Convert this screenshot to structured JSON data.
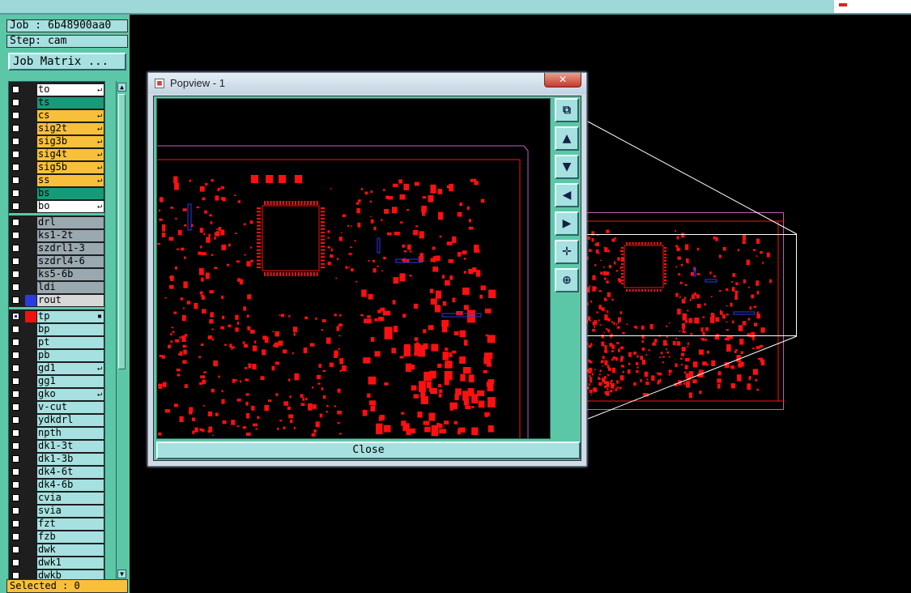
{
  "job_label": "Job : 6b48900aa0",
  "step_label": "Step: cam",
  "job_matrix_button": "Job Matrix ...",
  "selected_label": "Selected : 0",
  "popview_title": "Popview - 1",
  "close_button": "Close",
  "close_x": "✕",
  "colors": {
    "panel": "#5cc7a7",
    "light": "#a6e0e0",
    "orange": "#f8c03a",
    "teal": "#169a7a",
    "white": "#ffffff",
    "grey": "#9aa8b0",
    "copper": "#ff1010",
    "outline": "#c05cc0"
  },
  "layers": [
    {
      "name": "to",
      "bg": "#ffffff",
      "mark": "↵"
    },
    {
      "name": "ts",
      "bg": "#169a7a",
      "mark": ""
    },
    {
      "name": "cs",
      "bg": "#f8c03a",
      "mark": "↵"
    },
    {
      "name": "sig2t",
      "bg": "#f8c03a",
      "mark": "↵"
    },
    {
      "name": "sig3b",
      "bg": "#f8c03a",
      "mark": "↵"
    },
    {
      "name": "sig4t",
      "bg": "#f8c03a",
      "mark": "↵"
    },
    {
      "name": "sig5b",
      "bg": "#f8c03a",
      "mark": "↵"
    },
    {
      "name": "ss",
      "bg": "#f8c03a",
      "mark": "↵"
    },
    {
      "name": "bs",
      "bg": "#169a7a",
      "mark": ""
    },
    {
      "name": "bo",
      "bg": "#ffffff",
      "mark": "↵"
    },
    {
      "name": "drl",
      "bg": "#9aa8b0",
      "mark": ""
    },
    {
      "name": "ks1-2t",
      "bg": "#9aa8b0",
      "mark": ""
    },
    {
      "name": "szdrl1-3",
      "bg": "#9aa8b0",
      "mark": ""
    },
    {
      "name": "szdrl4-6",
      "bg": "#9aa8b0",
      "mark": ""
    },
    {
      "name": "ks5-6b",
      "bg": "#9aa8b0",
      "mark": ""
    },
    {
      "name": "ldi",
      "bg": "#9aa8b0",
      "mark": ""
    },
    {
      "name": "rout",
      "bg": "#d8d8d8",
      "mark": "",
      "swatch": "#2b3be0"
    },
    {
      "name": "tp",
      "bg": "#a6e0e0",
      "mark": "▪",
      "swatch": "#ee1111",
      "checked": true
    },
    {
      "name": "bp",
      "bg": "#a6e0e0",
      "mark": ""
    },
    {
      "name": "pt",
      "bg": "#a6e0e0",
      "mark": ""
    },
    {
      "name": "pb",
      "bg": "#a6e0e0",
      "mark": ""
    },
    {
      "name": "gd1",
      "bg": "#a6e0e0",
      "mark": "↵"
    },
    {
      "name": "gg1",
      "bg": "#a6e0e0",
      "mark": ""
    },
    {
      "name": "gko",
      "bg": "#a6e0e0",
      "mark": "↵"
    },
    {
      "name": "v-cut",
      "bg": "#a6e0e0",
      "mark": ""
    },
    {
      "name": "ydkdrl",
      "bg": "#a6e0e0",
      "mark": ""
    },
    {
      "name": "npth",
      "bg": "#a6e0e0",
      "mark": ""
    },
    {
      "name": "dk1-3t",
      "bg": "#a6e0e0",
      "mark": ""
    },
    {
      "name": "dk1-3b",
      "bg": "#a6e0e0",
      "mark": ""
    },
    {
      "name": "dk4-6t",
      "bg": "#a6e0e0",
      "mark": ""
    },
    {
      "name": "dk4-6b",
      "bg": "#a6e0e0",
      "mark": ""
    },
    {
      "name": "cvia",
      "bg": "#a6e0e0",
      "mark": ""
    },
    {
      "name": "svia",
      "bg": "#a6e0e0",
      "mark": ""
    },
    {
      "name": "fzt",
      "bg": "#a6e0e0",
      "mark": ""
    },
    {
      "name": "fzb",
      "bg": "#a6e0e0",
      "mark": ""
    },
    {
      "name": "dwk",
      "bg": "#a6e0e0",
      "mark": ""
    },
    {
      "name": "dwk1",
      "bg": "#a6e0e0",
      "mark": ""
    },
    {
      "name": "dwkb",
      "bg": "#a6e0e0",
      "mark": ""
    }
  ],
  "tools": [
    {
      "name": "zoom-home-icon",
      "glyph": "⧉"
    },
    {
      "name": "pan-up-icon",
      "glyph": "▲"
    },
    {
      "name": "pan-down-icon",
      "glyph": "▼"
    },
    {
      "name": "pan-left-icon",
      "glyph": "◀"
    },
    {
      "name": "pan-right-icon",
      "glyph": "▶"
    },
    {
      "name": "zoom-in-icon",
      "glyph": "✛"
    },
    {
      "name": "zoom-out-icon",
      "glyph": "⊕"
    }
  ]
}
